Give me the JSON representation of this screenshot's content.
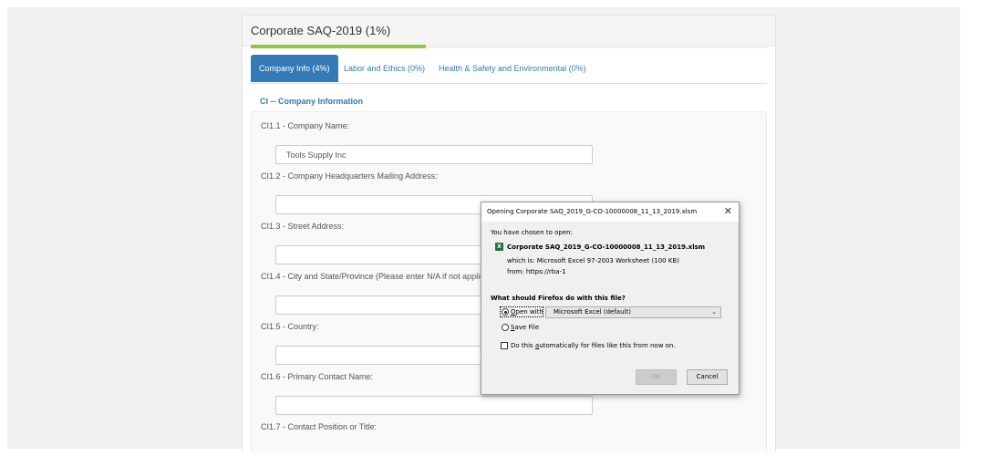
{
  "survey": {
    "title": "Corporate SAQ-2019 (1%)",
    "progress_fraction": 0.34,
    "tabs": [
      {
        "label": "Company Info (4%)"
      },
      {
        "label": "Labor and Ethics (0%)"
      },
      {
        "label": "Health & Safety and Environmental (0%)"
      }
    ],
    "section_title": "CI -- Company Information",
    "questions": [
      {
        "label": "CI1.1 - Company Name:",
        "value": "Tools Supply Inc"
      },
      {
        "label": "CI1.2 - Company Headquarters Mailing Address:",
        "value": ""
      },
      {
        "label": "CI1.3 - Street Address:",
        "value": ""
      },
      {
        "label": "CI1.4 - City and State/Province (Please enter N/A if not applicabl",
        "value": ""
      },
      {
        "label": "CI1.5 - Country:",
        "value": ""
      },
      {
        "label": "CI1.6 - Primary Contact Name:",
        "value": ""
      },
      {
        "label": "CI1.7 - Contact Position or Title:",
        "value": ""
      }
    ]
  },
  "dialog": {
    "title": "Opening Corporate SAQ_2019_G-CO-10000008_11_13_2019.xlsm",
    "close_label": "✕",
    "intro": "You have chosen to open:",
    "file_name": "Corporate SAQ_2019_G-CO-10000008_11_13_2019.xlsm",
    "which_is": "which is:  Microsoft Excel 97-2003 Worksheet (100 KB)",
    "from": "from:  https://rba-1",
    "question": "What should Firefox do with this file?",
    "open_with_mnemonic": "O",
    "open_with_rest": "pen with",
    "app_selected": "Microsoft Excel (default)",
    "save_mnemonic": "S",
    "save_rest": "ave File",
    "auto_pre": "Do this ",
    "auto_mnemonic": "a",
    "auto_rest": "utomatically for files like this from now on.",
    "ok_label": "OK",
    "cancel_label": "Cancel",
    "icon": "excel-file-icon"
  }
}
